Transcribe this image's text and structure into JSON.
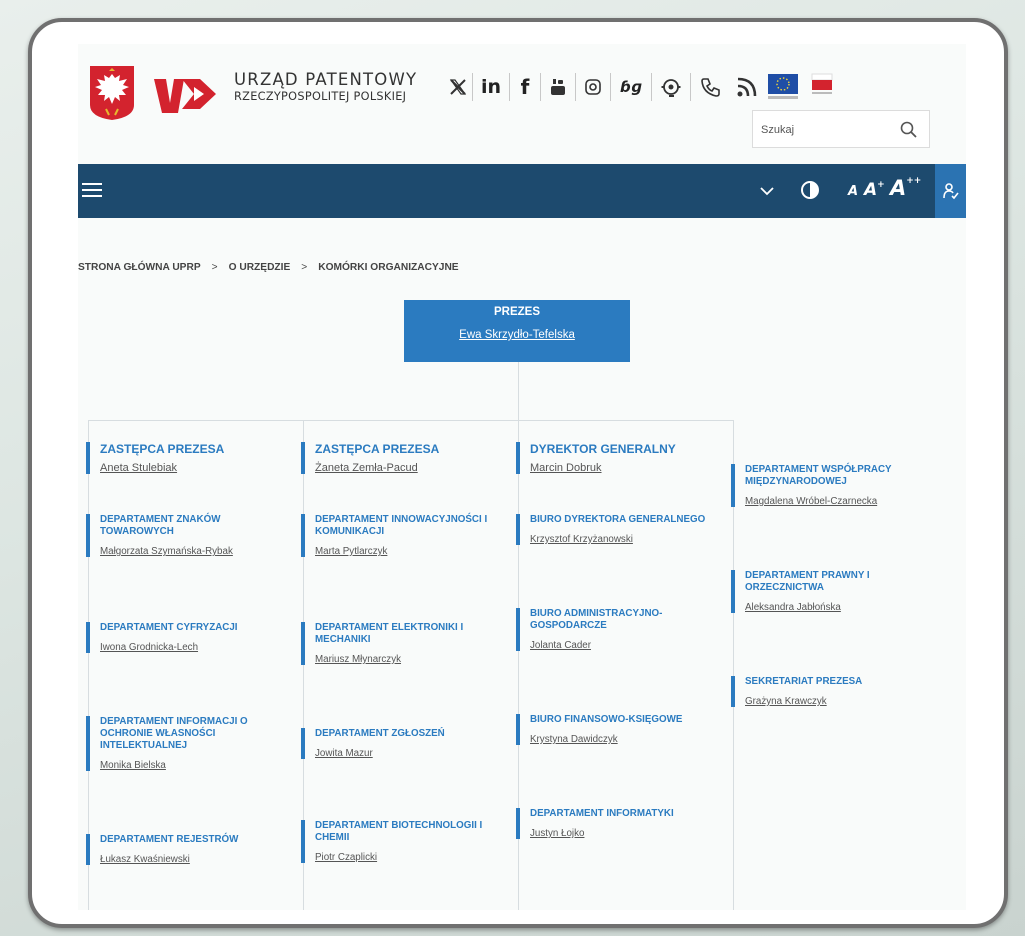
{
  "header": {
    "brand_line1": "URZĄD PATENTOWY",
    "brand_line2": "RZECZYPOSPOLITEJ POLSKIEJ",
    "search_placeholder": "Szukaj",
    "socials": [
      "x-icon",
      "linkedin-icon",
      "facebook-icon",
      "youtube-icon",
      "instagram-icon",
      "sign-language-icon",
      "helpline-icon",
      "phone-icon",
      "rss-icon",
      "eu-flag-icon",
      "bip-icon"
    ]
  },
  "toolbar": {
    "font_small": "A",
    "font_medium": "A",
    "font_medium_sup": "+",
    "font_large": "A",
    "font_large_sup": "++"
  },
  "breadcrumb": [
    "STRONA GŁÓWNA UPRP",
    "O URZĘDZIE",
    "KOMÓRKI ORGANIZACYJNE"
  ],
  "breadcrumb_sep": ">",
  "top": {
    "title": "PREZES",
    "name": "Ewa Skrzydło-Tefelska"
  },
  "columns": [
    {
      "head": {
        "title": "ZASTĘPCA PREZESA",
        "name": "Aneta Stulebiak"
      },
      "units": [
        {
          "title": "DEPARTAMENT ZNAKÓW TOWAROWYCH",
          "name": "Małgorzata Szymańska-Rybak"
        },
        {
          "title": "DEPARTAMENT CYFRYZACJI",
          "name": "Iwona Grodnicka-Lech"
        },
        {
          "title": "DEPARTAMENT INFORMACJI O OCHRONIE WŁASNOŚCI INTELEKTUALNEJ",
          "name": "Monika Bielska"
        },
        {
          "title": "DEPARTAMENT REJESTRÓW",
          "name": "Łukasz Kwaśniewski"
        }
      ]
    },
    {
      "head": {
        "title": "ZASTĘPCA PREZESA",
        "name": "Żaneta Zemła-Pacud"
      },
      "units": [
        {
          "title": "DEPARTAMENT INNOWACYJNOŚCI I KOMUNIKACJI",
          "name": "Marta Pytlarczyk"
        },
        {
          "title": "DEPARTAMENT ELEKTRONIKI I MECHANIKI",
          "name": "Mariusz Młynarczyk"
        },
        {
          "title": "DEPARTAMENT ZGŁOSZEŃ",
          "name": "Jowita Mazur"
        },
        {
          "title": "DEPARTAMENT BIOTECHNOLOGII I CHEMII",
          "name": "Piotr Czaplicki"
        }
      ]
    },
    {
      "head": {
        "title": "DYREKTOR GENERALNY",
        "name": "Marcin Dobruk"
      },
      "units": [
        {
          "title": "BIURO DYREKTORA GENERALNEGO",
          "name": "Krzysztof Krzyżanowski"
        },
        {
          "title": "BIURO ADMINISTRACYJNO-GOSPODARCZE",
          "name": "Jolanta Cader"
        },
        {
          "title": "BIURO FINANSOWO-KSIĘGOWE",
          "name": "Krystyna Dawidczyk"
        },
        {
          "title": "DEPARTAMENT INFORMATYKI",
          "name": "Justyn Łojko"
        }
      ]
    },
    {
      "units": [
        {
          "title": "DEPARTAMENT WSPÓŁPRACY MIĘDZYNARODOWEJ",
          "name": "Magdalena Wróbel-Czarnecka"
        },
        {
          "title": "DEPARTAMENT PRAWNY I ORZECZNICTWA",
          "name": "Aleksandra Jabłońska"
        },
        {
          "title": "SEKRETARIAT PREZESA",
          "name": "Grażyna Krawczyk"
        }
      ]
    }
  ],
  "colors": {
    "navbar": "#1d4a6e",
    "accent": "#2b7bc0"
  }
}
